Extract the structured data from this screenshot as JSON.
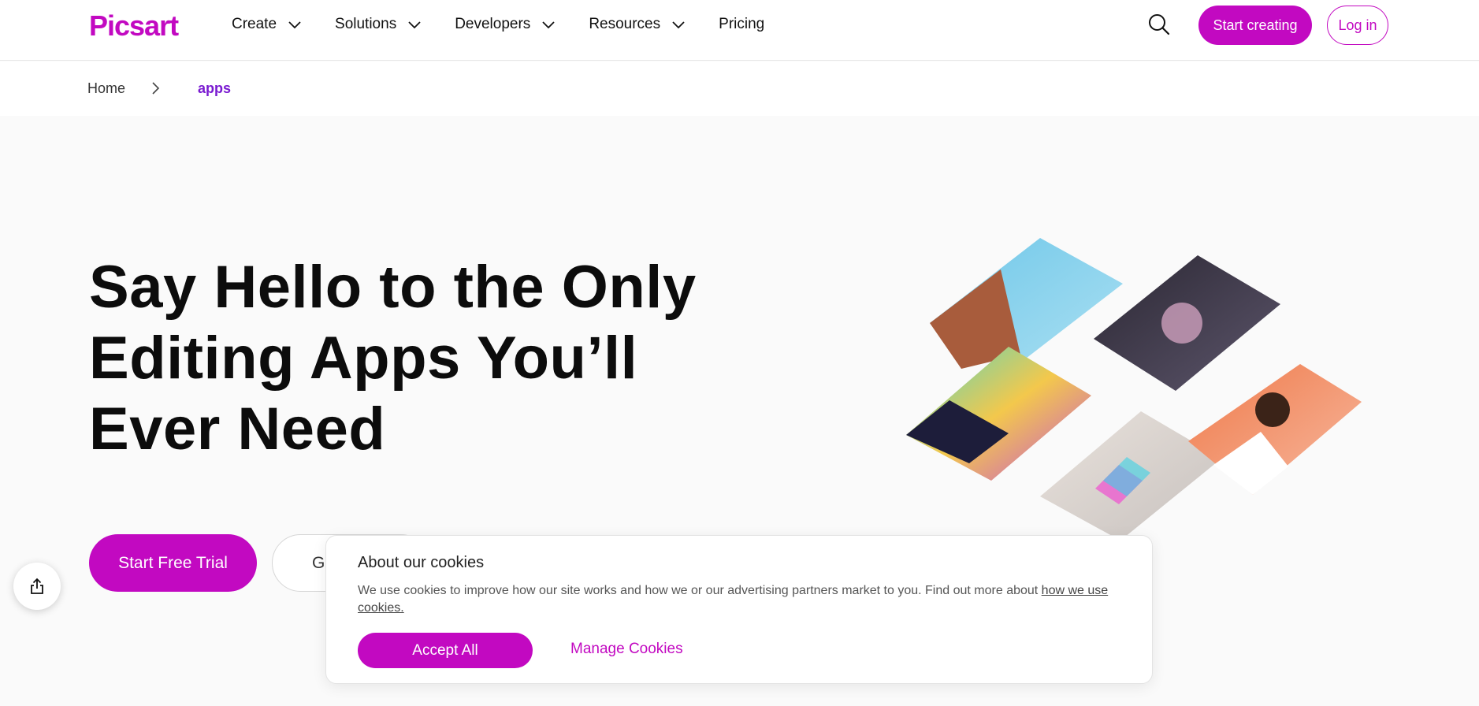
{
  "header": {
    "logo": "Picsart",
    "nav": [
      {
        "label": "Create",
        "has_dropdown": true
      },
      {
        "label": "Solutions",
        "has_dropdown": true
      },
      {
        "label": "Developers",
        "has_dropdown": true
      },
      {
        "label": "Resources",
        "has_dropdown": true
      },
      {
        "label": "Pricing",
        "has_dropdown": false
      }
    ],
    "search_icon": "search-icon",
    "start_creating": "Start creating",
    "login": "Log in"
  },
  "breadcrumb": {
    "home": "Home",
    "current": "apps"
  },
  "hero": {
    "title": "Say Hello to the Only Editing Apps You’ll Ever Need",
    "cta_primary": "Start Free Trial",
    "cta_secondary": "G"
  },
  "share": {
    "icon": "share-icon"
  },
  "cookie": {
    "title": "About our cookies",
    "text": "We use cookies to improve how our site works and how we or our advertising partners market to you. Find out more about ",
    "link": " how we use cookies.",
    "accept": "Accept All",
    "manage": "Manage Cookies"
  },
  "colors": {
    "brand": "#c209c1",
    "breadcrumb_active": "#7a1bd1",
    "background": "#fafafa"
  }
}
